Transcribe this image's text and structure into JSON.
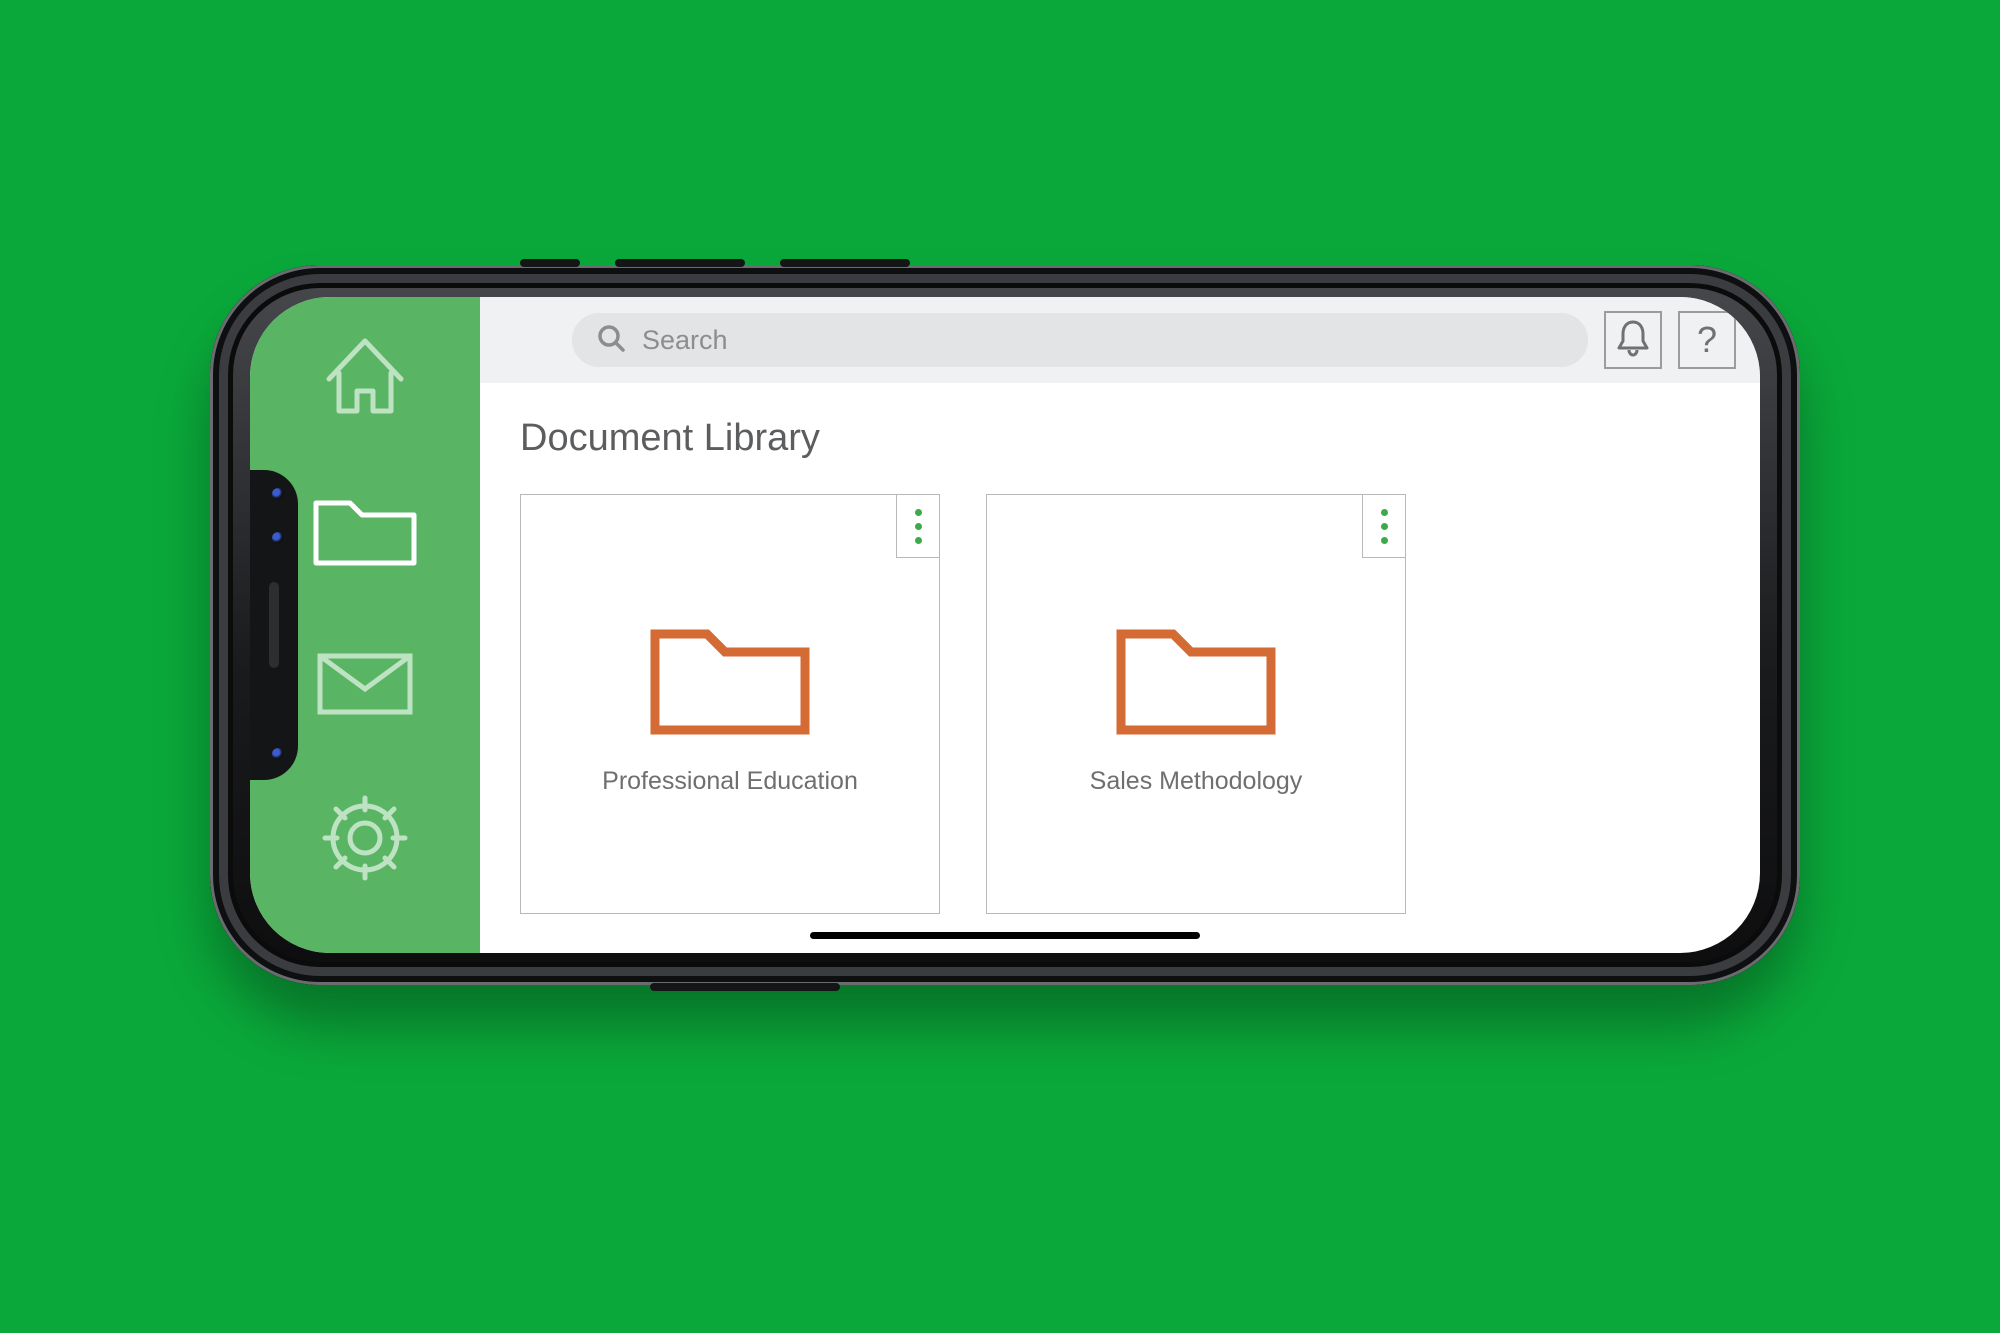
{
  "search": {
    "placeholder": "Search"
  },
  "page": {
    "title": "Document Library"
  },
  "help": {
    "glyph": "?"
  },
  "sidebar": {
    "items": [
      {
        "name": "home",
        "active": false
      },
      {
        "name": "folder",
        "active": true
      },
      {
        "name": "mail",
        "active": false
      },
      {
        "name": "settings",
        "active": false
      }
    ]
  },
  "folders": [
    {
      "label": "Professional Education"
    },
    {
      "label": "Sales Methodology"
    }
  ],
  "colors": {
    "background": "#0aa83a",
    "sidebar": "#59b564",
    "accent": "#3fa84a",
    "folder_icon": "#d46a34"
  }
}
